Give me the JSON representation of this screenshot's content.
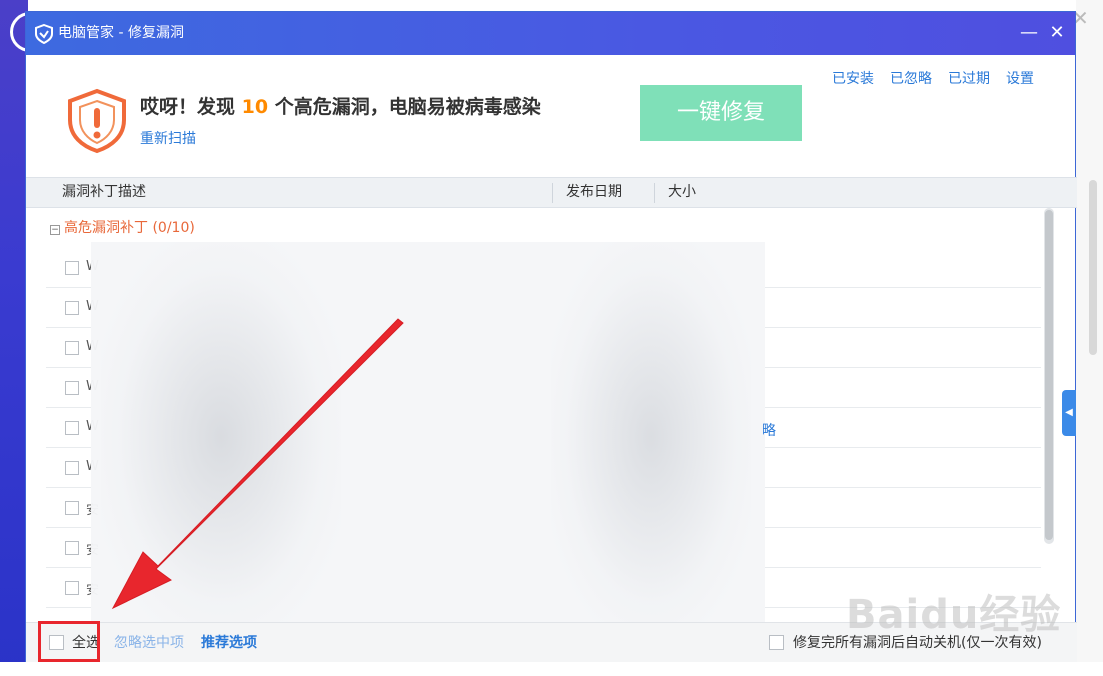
{
  "window": {
    "title": "电脑管家 - 修复漏洞",
    "minimize_label": "—",
    "close_label": "✕"
  },
  "header": {
    "alert_prefix": "哎呀！发现 ",
    "vuln_count": "10",
    "alert_suffix": " 个高危漏洞，电脑易被病毒感染",
    "rescan_link": "重新扫描",
    "fix_button": "一键修复",
    "links": [
      "已安装",
      "已忽略",
      "已过期",
      "设置"
    ]
  },
  "table": {
    "columns": [
      "漏洞补丁描述",
      "发布日期",
      "大小"
    ],
    "group_label": "高危漏洞补丁 (0/10)",
    "row_stub_chars": [
      "W",
      "W",
      "W",
      "W",
      "W",
      "W",
      "安",
      "安",
      "安"
    ],
    "peek_text": "略"
  },
  "footer": {
    "select_all": "全选",
    "ignore_selected": "忽略选中项",
    "recommended": "推荐选项",
    "auto_close": "修复完所有漏洞后自动关机(仅一次有效)"
  },
  "colors": {
    "title_bar": "#4a5fe2",
    "fix_button": "#7fe0b8",
    "count_accent": "#ff8a00",
    "link": "#2b7ad8",
    "group_label": "#e8683a",
    "highlight_box": "#e8262d"
  },
  "icons": {
    "title_logo": "shield-logo-icon",
    "alert": "shield-warning-icon",
    "desktop_close": "close-icon"
  },
  "watermark": "Baidu经验"
}
